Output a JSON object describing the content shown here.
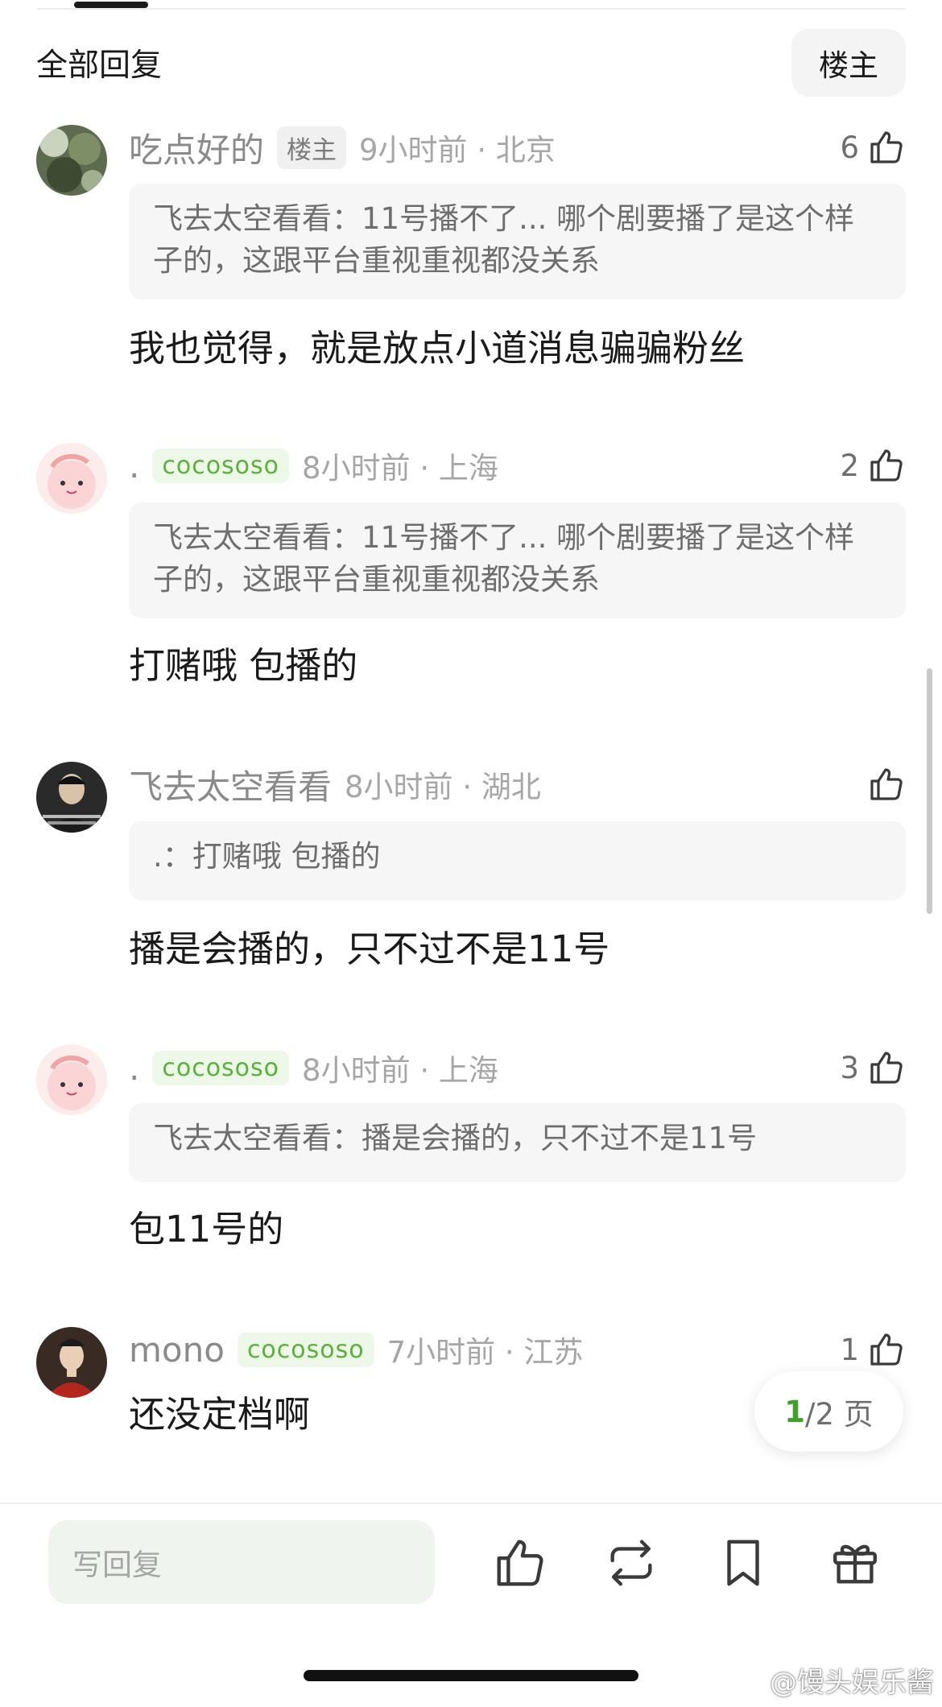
{
  "header": {
    "title": "全部回复",
    "filter_label": "楼主"
  },
  "comments": [
    {
      "username": "吃点好的",
      "tag": "楼主",
      "time_location": "9小时前 · 北京",
      "likes": "6",
      "quote": "飞去太空看看：11号播不了... 哪个剧要播了是这个样子的，这跟平台重视重视都没关系",
      "content": "我也觉得，就是放点小道消息骗骗粉丝"
    },
    {
      "username": ".",
      "tag": "cocososo",
      "time_location": "8小时前 · 上海",
      "likes": "2",
      "quote": "飞去太空看看：11号播不了... 哪个剧要播了是这个样子的，这跟平台重视重视都没关系",
      "content": "打赌哦 包播的"
    },
    {
      "username": "飞去太空看看",
      "time_location": "8小时前 · 湖北",
      "quote": ".：打赌哦 包播的",
      "content": "播是会播的，只不过不是11号"
    },
    {
      "username": ".",
      "tag": "cocososo",
      "time_location": "8小时前 · 上海",
      "likes": "3",
      "quote": "飞去太空看看：播是会播的，只不过不是11号",
      "content": "包11号的"
    },
    {
      "username": "mono",
      "tag": "cocososo",
      "time_location": "7小时前 · 江苏",
      "likes": "1",
      "content": "还没定档啊"
    }
  ],
  "pagination": {
    "current": "1",
    "rest": "/2 页"
  },
  "bottom_bar": {
    "reply_placeholder": "写回复",
    "icons": [
      "thumbs-up-icon",
      "repost-icon",
      "bookmark-icon",
      "gift-icon"
    ]
  },
  "watermark": "@馒头娱乐酱",
  "colors": {
    "accent_green": "#3fa12a",
    "tag_green_text": "#5ab23a",
    "tag_green_bg": "#edf8e8"
  }
}
